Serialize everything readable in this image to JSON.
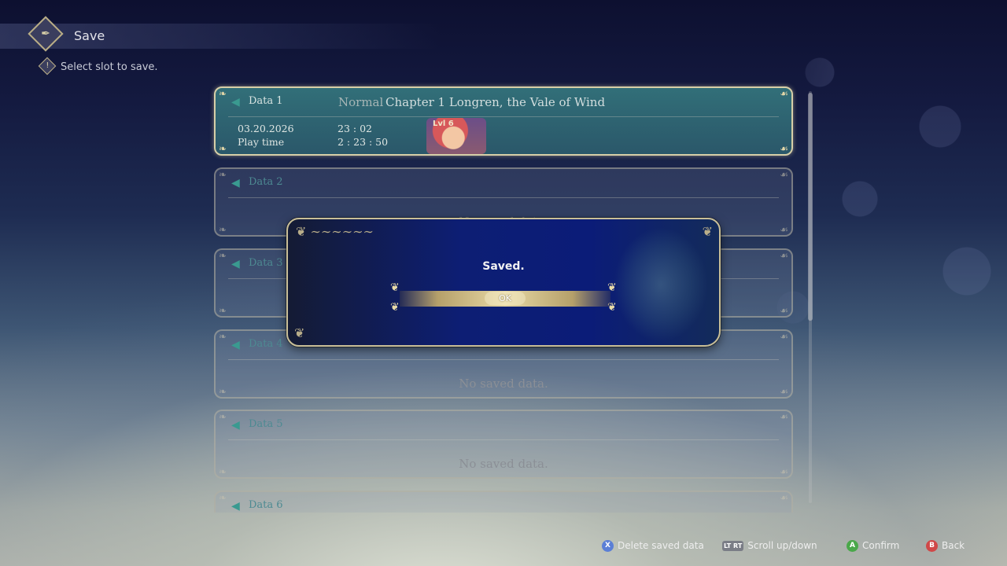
{
  "header": {
    "title": "Save",
    "hint": "Select slot to save.",
    "hint_icon": "exclamation-icon"
  },
  "slots": [
    {
      "label": "Data 1",
      "difficulty": "Normal",
      "chapter": "Chapter 1  Longren, the Vale of Wind",
      "date": "03.20.2026",
      "time": "23 : 02",
      "playtime_label": "Play time",
      "playtime": "2 : 23 : 50",
      "level": "Lvl 6"
    },
    {
      "label": "Data 2",
      "status": "No saved data."
    },
    {
      "label": "Data 3",
      "status": ""
    },
    {
      "label": "Data 4",
      "status": "No saved data."
    },
    {
      "label": "Data 5",
      "status": "No saved data."
    },
    {
      "label": "Data 6",
      "status": ""
    }
  ],
  "dialog": {
    "message": "Saved.",
    "ok_label": "OK"
  },
  "footer": [
    {
      "key": "X",
      "label": "Delete saved data",
      "color": "#5b7fd6"
    },
    {
      "key": "LT RT",
      "label": "Scroll up/down",
      "color": "#7a7d86"
    },
    {
      "key": "A",
      "label": "Confirm",
      "color": "#4aa84a"
    },
    {
      "key": "B",
      "label": "Back",
      "color": "#d04848"
    }
  ],
  "colors": {
    "active_slot": "#3a8c8c",
    "dialog_bg": "#0d1e74",
    "accent_gold": "#d7cfa8"
  }
}
